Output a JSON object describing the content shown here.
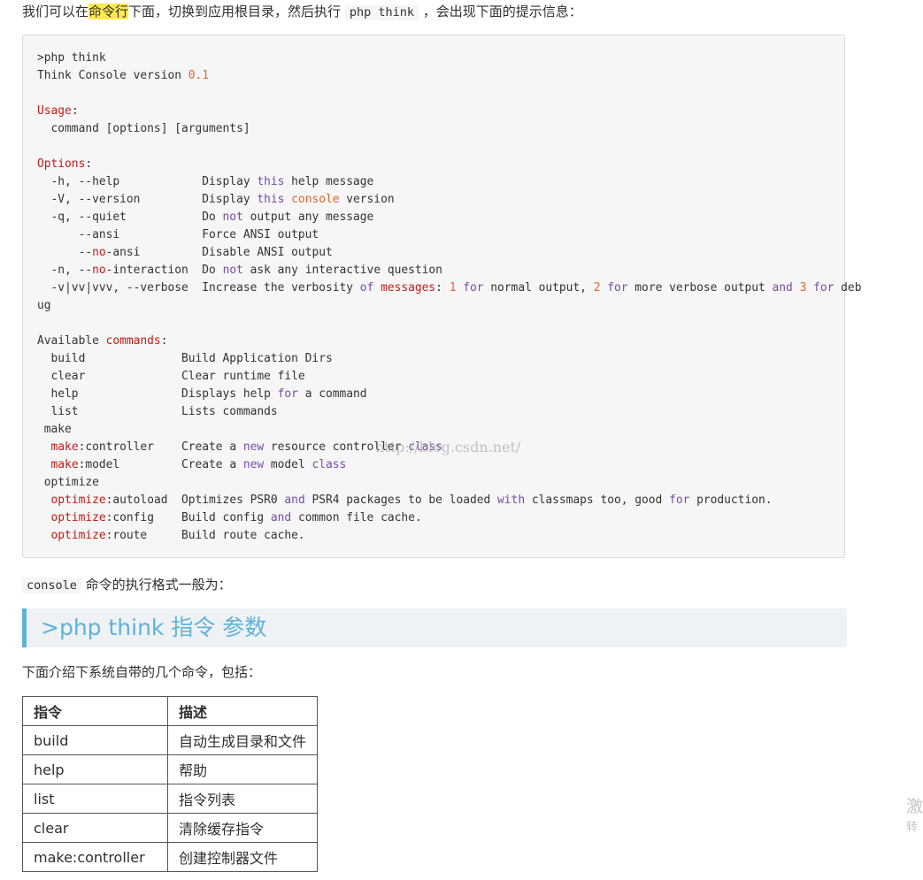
{
  "intro": {
    "before": "我们可以在",
    "highlight": "命令行",
    "middle": "下面，切换到应用根目录，然后执行 ",
    "code": "php think",
    "after": " ，会出现下面的提示信息："
  },
  "console_output": {
    "prompt": ">php think",
    "version_label": "Think Console version ",
    "version": "0.1",
    "usage_label": "Usage",
    "usage_line": "  command [options] [arguments]",
    "options_label": "Options",
    "available_label": "Available ",
    "commands_word": "commands",
    "colon": ":"
  },
  "watermark": "http://blog.csdn.net/",
  "console_note": {
    "code": "console",
    "text": " 命令的执行格式一般为："
  },
  "blockquote": ">php think 指令 参数",
  "list_intro": "下面介绍下系统自带的几个命令，包括：",
  "table": {
    "headers": [
      "指令",
      "描述"
    ],
    "rows": [
      [
        "build",
        "自动生成目录和文件"
      ],
      [
        "help",
        "帮助"
      ],
      [
        "list",
        "指令列表"
      ],
      [
        "clear",
        "清除缓存指令"
      ],
      [
        "make:controller",
        "创建控制器文件"
      ]
    ]
  },
  "side_text": {
    "line1": "激",
    "line2": "转"
  }
}
